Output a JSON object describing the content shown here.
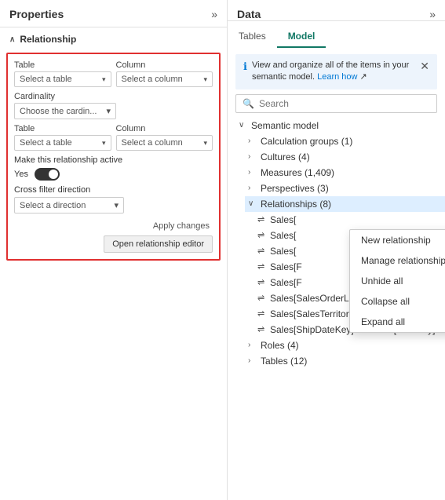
{
  "left": {
    "panel_title": "Properties",
    "expand_icon": "»",
    "section_label": "Relationship",
    "table1_label": "Table",
    "column1_label": "Column",
    "table1_placeholder": "Select a table",
    "column1_placeholder": "Select a column",
    "cardinality_label": "Cardinality",
    "cardinality_placeholder": "Choose the cardin...",
    "table2_label": "Table",
    "column2_label": "Column",
    "table2_placeholder": "Select a table",
    "column2_placeholder": "Select a column",
    "active_label": "Make this relationship active",
    "toggle_yes": "Yes",
    "cross_filter_label": "Cross filter direction",
    "direction_placeholder": "Select a direction",
    "apply_btn": "Apply changes",
    "editor_btn": "Open relationship editor"
  },
  "right": {
    "panel_title": "Data",
    "expand_icon": "»",
    "tabs": [
      "Tables",
      "Model"
    ],
    "active_tab": 1,
    "info_text": "View and organize all of the items in your semantic model.",
    "info_link": "Learn how",
    "search_placeholder": "Search",
    "tree": {
      "root": "Semantic model",
      "items": [
        {
          "label": "Calculation groups (1)",
          "indent": 1,
          "collapsed": true
        },
        {
          "label": "Cultures (4)",
          "indent": 1,
          "collapsed": true
        },
        {
          "label": "Measures (1,409)",
          "indent": 1,
          "collapsed": true
        },
        {
          "label": "Perspectives (3)",
          "indent": 1,
          "collapsed": true
        },
        {
          "label": "Relationships (8)",
          "indent": 1,
          "collapsed": false,
          "highlighted": true
        },
        {
          "label": "Sales[",
          "indent": 2,
          "icon": "rel"
        },
        {
          "label": "Sales[",
          "indent": 2,
          "icon": "rel"
        },
        {
          "label": "Sales[",
          "indent": 2,
          "icon": "rel"
        },
        {
          "label": "Sales[F",
          "indent": 2,
          "icon": "rel"
        },
        {
          "label": "Sales[F",
          "indent": 2,
          "icon": "rel"
        },
        {
          "label": "Sales[SalesOrderLineKey] — Sales Or...",
          "indent": 2,
          "icon": "rel"
        },
        {
          "label": "Sales[SalesTerritoryKey] <— Sales Te...",
          "indent": 2,
          "icon": "rel"
        },
        {
          "label": "Sales[ShipDateKey] <— Date[DateKey]",
          "indent": 2,
          "icon": "rel"
        },
        {
          "label": "Roles (4)",
          "indent": 1,
          "collapsed": true
        },
        {
          "label": "Tables (12)",
          "indent": 1,
          "collapsed": true
        }
      ]
    },
    "context_menu": [
      "New relationship",
      "Manage relationships",
      "Unhide all",
      "Collapse all",
      "Expand all"
    ]
  }
}
